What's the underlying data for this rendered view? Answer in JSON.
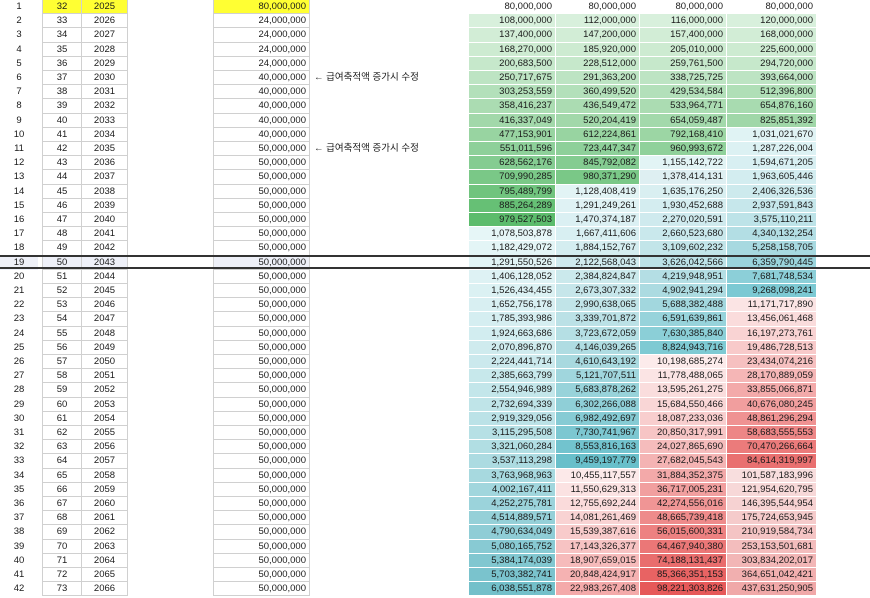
{
  "note_text": "← 급여축적액 증가시 수정",
  "rows": [
    {
      "i": "1",
      "age": "32",
      "yr": "2025",
      "amt": "80,000,000",
      "c": [
        "80,000,000",
        "80,000,000",
        "80,000,000",
        "80,000,000"
      ],
      "bg": [
        "#ffffff",
        "#ffffff",
        "#ffffff",
        "#ffffff"
      ],
      "yellow": true
    },
    {
      "i": "2",
      "age": "33",
      "yr": "2026",
      "amt": "24,000,000",
      "c": [
        "108,000,000",
        "112,000,000",
        "116,000,000",
        "120,000,000"
      ],
      "bg": [
        "#d8f0dc",
        "#d8f0dc",
        "#d8f0dc",
        "#d8f0dc"
      ]
    },
    {
      "i": "3",
      "age": "34",
      "yr": "2027",
      "amt": "24,000,000",
      "c": [
        "137,400,000",
        "147,200,000",
        "157,400,000",
        "168,000,000"
      ],
      "bg": [
        "#d2edd6",
        "#d2edd6",
        "#d2edd6",
        "#d2edd6"
      ]
    },
    {
      "i": "4",
      "age": "35",
      "yr": "2028",
      "amt": "24,000,000",
      "c": [
        "168,270,000",
        "185,920,000",
        "205,010,000",
        "225,600,000"
      ],
      "bg": [
        "#cdebd1",
        "#cdebd1",
        "#cdebd1",
        "#cdebd1"
      ]
    },
    {
      "i": "5",
      "age": "36",
      "yr": "2029",
      "amt": "24,000,000",
      "c": [
        "200,683,500",
        "228,512,000",
        "259,761,500",
        "294,720,000"
      ],
      "bg": [
        "#c6e8cb",
        "#c6e8cb",
        "#c6e8cb",
        "#c6e8cb"
      ]
    },
    {
      "i": "6",
      "age": "37",
      "yr": "2030",
      "amt": "40,000,000",
      "note": true,
      "c": [
        "250,717,675",
        "291,363,200",
        "338,725,725",
        "393,664,000"
      ],
      "bg": [
        "#bde4c3",
        "#bde4c3",
        "#bde4c3",
        "#bde4c3"
      ]
    },
    {
      "i": "7",
      "age": "38",
      "yr": "2031",
      "amt": "40,000,000",
      "c": [
        "303,253,559",
        "360,499,520",
        "429,534,584",
        "512,396,800"
      ],
      "bg": [
        "#b3e0ba",
        "#b3e0ba",
        "#b3e0ba",
        "#b0dfb7"
      ]
    },
    {
      "i": "8",
      "age": "39",
      "yr": "2032",
      "amt": "40,000,000",
      "c": [
        "358,416,237",
        "436,549,472",
        "533,964,771",
        "654,876,160"
      ],
      "bg": [
        "#abdcb2",
        "#abdcb2",
        "#abdcb2",
        "#a8dbb0"
      ]
    },
    {
      "i": "9",
      "age": "40",
      "yr": "2033",
      "amt": "40,000,000",
      "c": [
        "416,337,049",
        "520,204,419",
        "654,059,487",
        "825,851,392"
      ],
      "bg": [
        "#a2d8aa",
        "#a2d8aa",
        "#a3d9ab",
        "#a0d7a8"
      ]
    },
    {
      "i": "10",
      "age": "41",
      "yr": "2034",
      "amt": "40,000,000",
      "c": [
        "477,153,901",
        "612,224,861",
        "792,168,410",
        "1,031,021,670"
      ],
      "bg": [
        "#98d4a1",
        "#98d4a1",
        "#9cd6a4",
        "#e0f3f4"
      ]
    },
    {
      "i": "11",
      "age": "42",
      "yr": "2035",
      "amt": "50,000,000",
      "note": true,
      "c": [
        "551,011,596",
        "723,447,347",
        "960,993,672",
        "1,287,226,004"
      ],
      "bg": [
        "#8ed09a",
        "#8ed09a",
        "#90d19b",
        "#dcf1f3"
      ]
    },
    {
      "i": "12",
      "age": "43",
      "yr": "2036",
      "amt": "50,000,000",
      "c": [
        "628,562,176",
        "845,792,082",
        "1,155,142,722",
        "1,594,671,205"
      ],
      "bg": [
        "#84cc91",
        "#84cc91",
        "#e2f4f5",
        "#d8eff2"
      ]
    },
    {
      "i": "13",
      "age": "44",
      "yr": "2037",
      "amt": "50,000,000",
      "c": [
        "709,990,285",
        "980,371,290",
        "1,378,414,131",
        "1,963,605,446"
      ],
      "bg": [
        "#7ac887",
        "#7ac887",
        "#deeff2",
        "#d3edf0"
      ]
    },
    {
      "i": "14",
      "age": "45",
      "yr": "2038",
      "amt": "50,000,000",
      "c": [
        "795,489,799",
        "1,128,408,419",
        "1,635,176,250",
        "2,406,326,536"
      ],
      "bg": [
        "#70c47e",
        "#e2f4f5",
        "#d9eff1",
        "#cdeaed"
      ]
    },
    {
      "i": "15",
      "age": "46",
      "yr": "2039",
      "amt": "50,000,000",
      "c": [
        "885,264,289",
        "1,291,249,261",
        "1,930,452,688",
        "2,937,591,843"
      ],
      "bg": [
        "#66c075",
        "#dff2f4",
        "#d4edf0",
        "#c6e7eb"
      ]
    },
    {
      "i": "16",
      "age": "47",
      "yr": "2040",
      "amt": "50,000,000",
      "c": [
        "979,527,503",
        "1,470,374,187",
        "2,270,020,591",
        "3,575,110,211"
      ],
      "bg": [
        "#5cbc6c",
        "#dbf0f3",
        "#cfeaee",
        "#bde3e8"
      ]
    },
    {
      "i": "17",
      "age": "48",
      "yr": "2041",
      "amt": "50,000,000",
      "c": [
        "1,078,503,878",
        "1,667,411,606",
        "2,660,523,680",
        "4,340,132,254"
      ],
      "bg": [
        "#e6f6f7",
        "#d8eff2",
        "#c9e8ec",
        "#b3dee4"
      ]
    },
    {
      "i": "18",
      "age": "49",
      "yr": "2042",
      "amt": "50,000,000",
      "c": [
        "1,182,429,072",
        "1,884,152,767",
        "3,109,602,232",
        "5,258,158,705"
      ],
      "bg": [
        "#e3f5f6",
        "#d4edf0",
        "#c2e5e9",
        "#a7d9e0"
      ]
    },
    {
      "i": "19",
      "age": "50",
      "yr": "2043",
      "amt": "50,000,000",
      "c": [
        "1,291,550,526",
        "2,122,568,043",
        "3,626,042,566",
        "6,359,790,445"
      ],
      "bg": [
        "#e1f4f5",
        "#cfeaee",
        "#bce2e7",
        "#9ad4dc"
      ],
      "selected": true
    },
    {
      "i": "20",
      "age": "51",
      "yr": "2044",
      "amt": "50,000,000",
      "c": [
        "1,406,128,052",
        "2,384,824,847",
        "4,219,948,951",
        "7,681,748,534"
      ],
      "bg": [
        "#def2f4",
        "#cbe9ec",
        "#b4dee4",
        "#8ccfd8"
      ]
    },
    {
      "i": "21",
      "age": "52",
      "yr": "2045",
      "amt": "50,000,000",
      "c": [
        "1,526,434,455",
        "2,673,307,332",
        "4,902,941,294",
        "9,268,098,241"
      ],
      "bg": [
        "#dbf1f3",
        "#c6e6ea",
        "#acdbe1",
        "#7cc9d3"
      ]
    },
    {
      "i": "22",
      "age": "53",
      "yr": "2046",
      "amt": "50,000,000",
      "c": [
        "1,652,756,178",
        "2,990,638,065",
        "5,688,382,488",
        "11,171,717,890"
      ],
      "bg": [
        "#d8eff2",
        "#c1e4e8",
        "#a2d7de",
        "#fbe4e4"
      ]
    },
    {
      "i": "23",
      "age": "54",
      "yr": "2047",
      "amt": "50,000,000",
      "c": [
        "1,785,393,986",
        "3,339,701,872",
        "6,591,639,861",
        "13,456,061,468"
      ],
      "bg": [
        "#d5eef1",
        "#bbe1e6",
        "#97d3db",
        "#fadcdc"
      ]
    },
    {
      "i": "24",
      "age": "55",
      "yr": "2048",
      "amt": "50,000,000",
      "c": [
        "1,924,663,686",
        "3,723,672,059",
        "7,630,385,840",
        "16,197,273,761"
      ],
      "bg": [
        "#d2edf0",
        "#b5dfe4",
        "#8bcfd7",
        "#f9d3d3"
      ]
    },
    {
      "i": "25",
      "age": "56",
      "yr": "2049",
      "amt": "50,000,000",
      "c": [
        "2,070,896,870",
        "4,146,039,265",
        "8,824,943,716",
        "19,486,728,513"
      ],
      "bg": [
        "#cfebee",
        "#afdce2",
        "#7ecad3",
        "#f8caca"
      ]
    },
    {
      "i": "26",
      "age": "57",
      "yr": "2050",
      "amt": "50,000,000",
      "c": [
        "2,224,441,714",
        "4,610,643,192",
        "10,198,685,274",
        "23,434,074,216"
      ],
      "bg": [
        "#cbe9ed",
        "#a8d9df",
        "#fcebeb",
        "#f6c0c0"
      ]
    },
    {
      "i": "27",
      "age": "58",
      "yr": "2051",
      "amt": "50,000,000",
      "c": [
        "2,385,663,799",
        "5,121,707,511",
        "11,778,488,065",
        "28,170,889,059"
      ],
      "bg": [
        "#c7e8eb",
        "#a0d6dd",
        "#fbe4e4",
        "#f5b6b6"
      ]
    },
    {
      "i": "28",
      "age": "59",
      "yr": "2052",
      "amt": "50,000,000",
      "c": [
        "2,554,946,989",
        "5,683,878,262",
        "13,595,261,275",
        "33,855,066,871"
      ],
      "bg": [
        "#c3e6ea",
        "#98d3da",
        "#fadddd",
        "#f3aaaa"
      ]
    },
    {
      "i": "29",
      "age": "60",
      "yr": "2053",
      "amt": "50,000,000",
      "c": [
        "2,732,694,339",
        "6,302,266,088",
        "15,684,550,466",
        "40,676,080,245"
      ],
      "bg": [
        "#bfe4e8",
        "#8fcfd7",
        "#f9d6d6",
        "#f19e9e"
      ]
    },
    {
      "i": "30",
      "age": "61",
      "yr": "2054",
      "amt": "50,000,000",
      "c": [
        "2,919,329,056",
        "6,982,492,697",
        "18,087,233,036",
        "48,861,296,294"
      ],
      "bg": [
        "#bbe2e7",
        "#86cbd4",
        "#f8cece",
        "#ef9292"
      ]
    },
    {
      "i": "31",
      "age": "62",
      "yr": "2055",
      "amt": "50,000,000",
      "c": [
        "3,115,295,508",
        "7,730,741,967",
        "20,850,317,991",
        "58,683,555,553"
      ],
      "bg": [
        "#b6e0e5",
        "#7cc7d1",
        "#f7c5c5",
        "#ed8686"
      ]
    },
    {
      "i": "32",
      "age": "63",
      "yr": "2056",
      "amt": "50,000,000",
      "c": [
        "3,321,060,284",
        "8,553,816,163",
        "24,027,865,690",
        "70,470,266,664"
      ],
      "bg": [
        "#b1dee3",
        "#72c3ce",
        "#f5bcbc",
        "#eb7b7b"
      ]
    },
    {
      "i": "33",
      "age": "64",
      "yr": "2057",
      "amt": "50,000,000",
      "c": [
        "3,537,113,298",
        "9,459,197,779",
        "27,682,045,543",
        "84,614,319,997"
      ],
      "bg": [
        "#acdbe1",
        "#68bfca",
        "#f4b3b3",
        "#e97070"
      ]
    },
    {
      "i": "34",
      "age": "65",
      "yr": "2058",
      "amt": "50,000,000",
      "c": [
        "3,763,968,963",
        "10,455,117,557",
        "31,884,352,375",
        "101,587,183,996"
      ],
      "bg": [
        "#a7d9df",
        "#fce9e9",
        "#f3a9a9",
        "#f8dede"
      ]
    },
    {
      "i": "35",
      "age": "66",
      "yr": "2059",
      "amt": "50,000,000",
      "c": [
        "4,002,167,411",
        "11,550,629,313",
        "36,717,005,231",
        "121,954,620,795"
      ],
      "bg": [
        "#a1d6dd",
        "#fbe2e2",
        "#f19f9f",
        "#f7d8d8"
      ]
    },
    {
      "i": "36",
      "age": "67",
      "yr": "2060",
      "amt": "50,000,000",
      "c": [
        "4,252,275,781",
        "12,755,692,244",
        "42,274,556,016",
        "146,395,544,954"
      ],
      "bg": [
        "#9bd3db",
        "#fadbdb",
        "#f09595",
        "#f6d2d2"
      ]
    },
    {
      "i": "37",
      "age": "68",
      "yr": "2061",
      "amt": "50,000,000",
      "c": [
        "4,514,889,571",
        "14,081,261,469",
        "48,665,739,418",
        "175,724,653,945"
      ],
      "bg": [
        "#95d0d8",
        "#f9d3d3",
        "#ee8b8b",
        "#f5cbcb"
      ]
    },
    {
      "i": "38",
      "age": "69",
      "yr": "2062",
      "amt": "50,000,000",
      "c": [
        "4,790,634,049",
        "15,539,387,616",
        "56,015,600,331",
        "210,919,584,734"
      ],
      "bg": [
        "#8fcdd6",
        "#f8cbcb",
        "#ed8181",
        "#f4c4c4"
      ]
    },
    {
      "i": "39",
      "age": "70",
      "yr": "2063",
      "amt": "50,000,000",
      "c": [
        "5,080,165,752",
        "17,143,326,377",
        "64,467,940,380",
        "253,153,501,681"
      ],
      "bg": [
        "#88cad3",
        "#f7c3c3",
        "#eb7777",
        "#f3bdbd"
      ]
    },
    {
      "i": "40",
      "age": "71",
      "yr": "2064",
      "amt": "50,000,000",
      "c": [
        "5,384,174,039",
        "18,907,659,015",
        "74,188,131,437",
        "303,834,202,017"
      ],
      "bg": [
        "#81c7d0",
        "#f6bbbb",
        "#e96d6d",
        "#f2b6b6"
      ]
    },
    {
      "i": "41",
      "age": "72",
      "yr": "2065",
      "amt": "50,000,000",
      "c": [
        "5,703,382,741",
        "20,848,424,917",
        "85,366,351,153",
        "364,651,042,421"
      ],
      "bg": [
        "#7ac3cd",
        "#f5b2b2",
        "#e86363",
        "#f1afaf"
      ]
    },
    {
      "i": "42",
      "age": "73",
      "yr": "2066",
      "amt": "50,000,000",
      "c": [
        "6,038,551,878",
        "22,983,267,408",
        "98,221,303,826",
        "437,631,250,905"
      ],
      "bg": [
        "#73c0ca",
        "#f4aaaa",
        "#e65959",
        "#f0a8a8"
      ]
    }
  ]
}
